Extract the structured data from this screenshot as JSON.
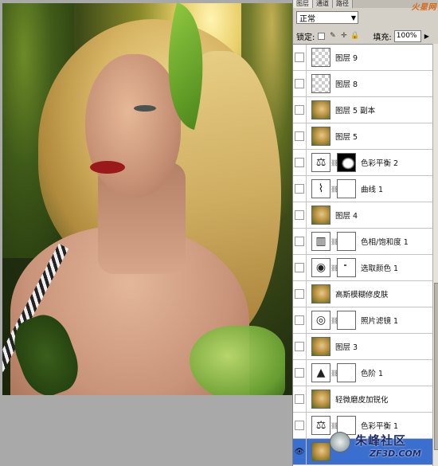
{
  "panel": {
    "tabs": [
      "图层",
      "通道",
      "路径"
    ],
    "watermark_top": "火星网",
    "blend_mode": "正常",
    "lock_label": "锁定:",
    "fill_label": "填充:",
    "fill_value": "100%"
  },
  "layers": [
    {
      "name": "图层 9",
      "thumb": "transparent",
      "visible": false
    },
    {
      "name": "图层 8",
      "thumb": "transparent",
      "visible": false
    },
    {
      "name": "图层 5 副本",
      "thumb": "photo",
      "visible": false
    },
    {
      "name": "图层 5",
      "thumb": "photo",
      "visible": false
    },
    {
      "name": "色彩平衡 2",
      "thumb": "adjustment",
      "icon": "balance-icon",
      "mask": "dark",
      "visible": false
    },
    {
      "name": "曲线 1",
      "thumb": "adjustment",
      "icon": "curves-icon",
      "mask": "white",
      "visible": false
    },
    {
      "name": "图层 4",
      "thumb": "photo",
      "visible": false
    },
    {
      "name": "色相/饱和度 1",
      "thumb": "adjustment",
      "icon": "hue-saturation-icon",
      "mask": "white",
      "visible": false
    },
    {
      "name": "选取颜色 1",
      "thumb": "adjustment",
      "icon": "selective-color-icon",
      "mask": "speck",
      "visible": false
    },
    {
      "name": "高斯模糊修皮肤",
      "thumb": "photo",
      "visible": false
    },
    {
      "name": "照片滤镜 1",
      "thumb": "adjustment",
      "icon": "photo-filter-icon",
      "mask": "white",
      "visible": false
    },
    {
      "name": "图层 3",
      "thumb": "photo",
      "visible": false
    },
    {
      "name": "色阶 1",
      "thumb": "adjustment",
      "icon": "levels-icon",
      "mask": "white",
      "visible": false
    },
    {
      "name": "轻微磨皮加锐化",
      "thumb": "photo",
      "visible": false
    },
    {
      "name": "色彩平衡 1",
      "thumb": "adjustment",
      "icon": "balance-icon",
      "mask": "white",
      "visible": false
    },
    {
      "name": "",
      "thumb": "photo",
      "visible": true,
      "selected": true
    }
  ],
  "watermark_bottom": {
    "text": "朱峰社区",
    "url": "ZF3D.COM"
  },
  "colors": {
    "selected_layer": "#3a6fcf",
    "panel_bg": "#d4d0c8",
    "canvas_bg": "#a9a9a9"
  }
}
